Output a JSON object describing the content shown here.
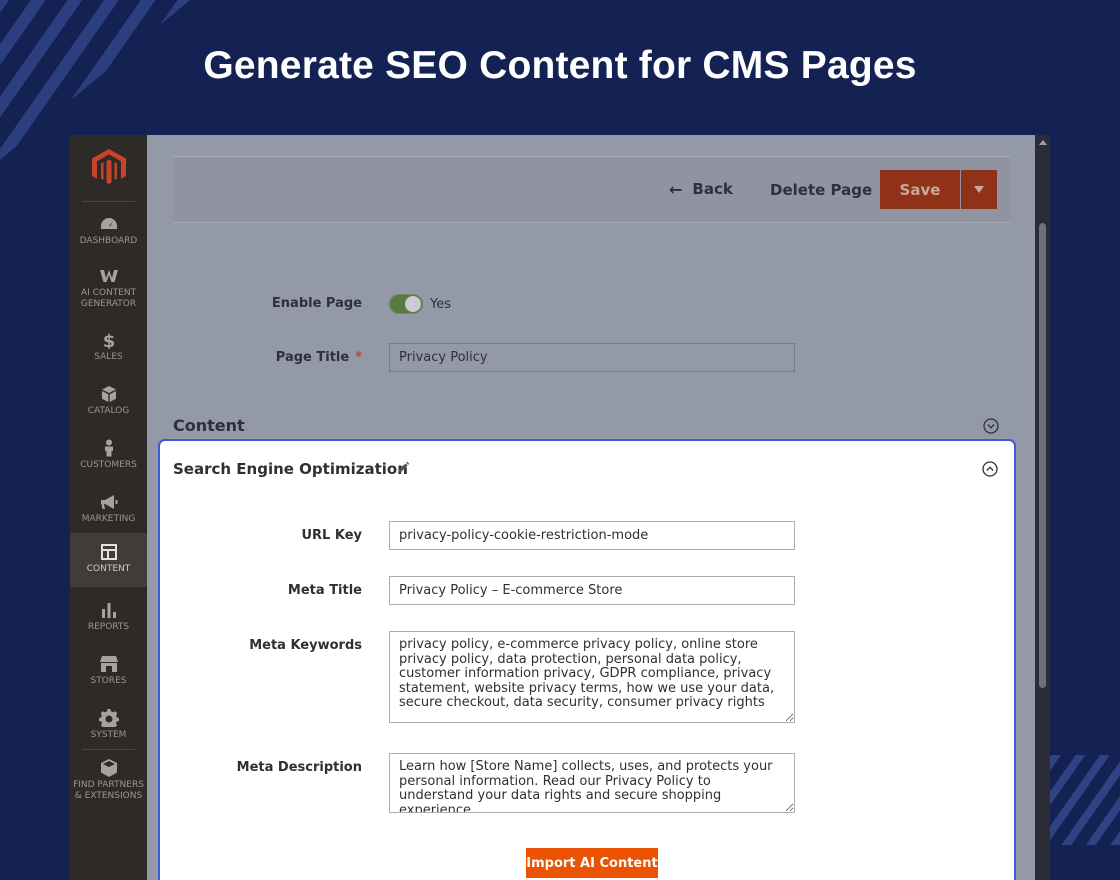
{
  "headline": "Generate SEO Content for CMS Pages",
  "sidebar": {
    "items": [
      {
        "label": "DASHBOARD",
        "icon": "dashboard-icon"
      },
      {
        "label": "AI CONTENT GENERATOR",
        "icon": "ai-content-icon"
      },
      {
        "label": "SALES",
        "icon": "dollar-icon"
      },
      {
        "label": "CATALOG",
        "icon": "box-icon"
      },
      {
        "label": "CUSTOMERS",
        "icon": "person-icon"
      },
      {
        "label": "MARKETING",
        "icon": "megaphone-icon"
      },
      {
        "label": "CONTENT",
        "icon": "layout-icon"
      },
      {
        "label": "REPORTS",
        "icon": "bar-chart-icon"
      },
      {
        "label": "STORES",
        "icon": "storefront-icon"
      },
      {
        "label": "SYSTEM",
        "icon": "gear-icon"
      },
      {
        "label": "FIND PARTNERS & EXTENSIONS",
        "icon": "cube-icon"
      }
    ]
  },
  "toolbar": {
    "back_label": "Back",
    "delete_label": "Delete Page",
    "save_label": "Save"
  },
  "form": {
    "enable_page_label": "Enable Page",
    "enable_page_value": "Yes",
    "page_title_label": "Page Title",
    "page_title_required": "*",
    "page_title_value": "Privacy Policy",
    "content_section_title": "Content"
  },
  "seo": {
    "title": "Search Engine Optimization",
    "url_key_label": "URL Key",
    "url_key_value": "privacy-policy-cookie-restriction-mode",
    "meta_title_label": "Meta Title",
    "meta_title_value": "Privacy Policy – E-commerce Store",
    "meta_keywords_label": "Meta Keywords",
    "meta_keywords_value": "privacy policy, e-commerce privacy policy, online store privacy policy, data protection, personal data policy, customer information privacy, GDPR compliance, privacy statement, website privacy terms, how we use your data, secure checkout, data security, consumer privacy rights",
    "meta_description_label": "Meta Description",
    "meta_description_value": "Learn how [Store Name] collects, uses, and protects your personal information. Read our Privacy Policy to understand your data rights and secure shopping experience.",
    "import_label": "Import AI Content"
  },
  "colors": {
    "background": "#132153",
    "accent_orange": "#eb5202",
    "panel_border": "#3b5bdb",
    "sidebar": "#2d2a28"
  }
}
